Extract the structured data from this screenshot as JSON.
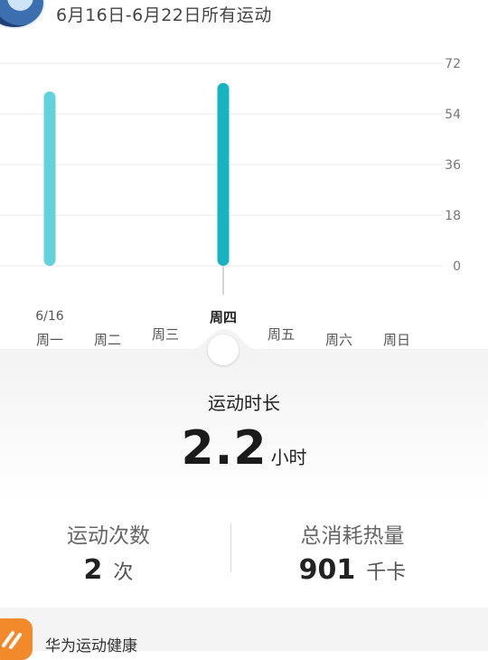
{
  "header": {
    "range_title": "6月16日-6月22日所有运动"
  },
  "chart_data": {
    "type": "bar",
    "categories": [
      "周一",
      "周二",
      "周三",
      "周四",
      "周五",
      "周六",
      "周日"
    ],
    "values": [
      62,
      0,
      0,
      65,
      0,
      0,
      0
    ],
    "y_ticks": [
      0,
      18,
      36,
      54,
      72
    ],
    "ylim": [
      0,
      72
    ],
    "first_date_label": "6/16",
    "selected_category": "周四",
    "grid": true,
    "colors": {
      "bar": "#62d2dd",
      "bar_selected": "#16b4c0"
    }
  },
  "summary": {
    "title": "运动时长",
    "value": "2.2",
    "unit": "小时"
  },
  "stats": {
    "count_label": "运动次数",
    "count_value": "2",
    "count_unit": "次",
    "calories_label": "总消耗热量",
    "calories_value": "901",
    "calories_unit": "千卡"
  },
  "footer": {
    "app_name": "华为运动健康"
  },
  "colors": {
    "accent": "#16b4c0",
    "app_icon": "#f28a2b"
  }
}
